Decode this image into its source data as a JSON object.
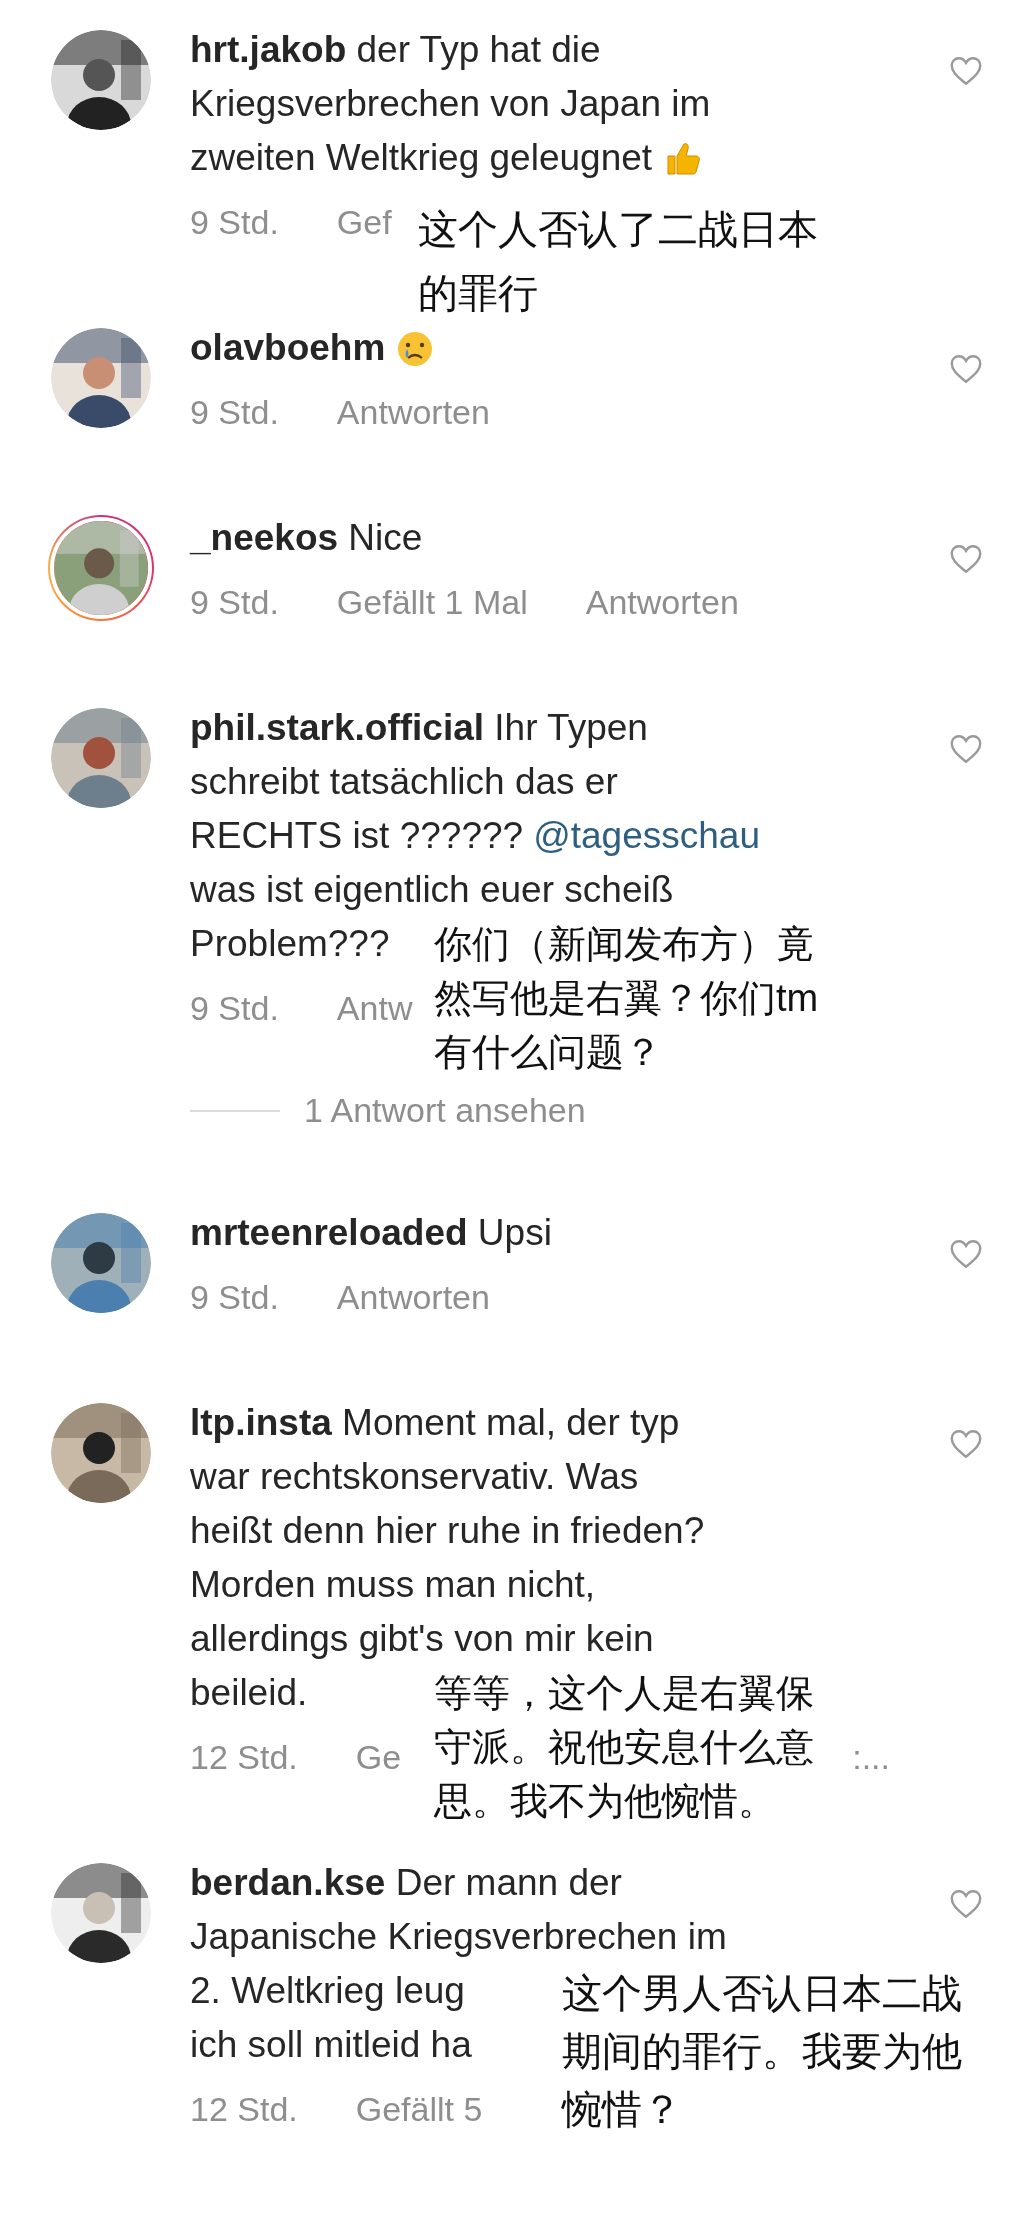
{
  "comments": [
    {
      "avatar": {
        "kind": "picture",
        "story_ring": false
      },
      "lines": [
        [
          {
            "kind": "text",
            "text": "**hrt.jakob** der Typ hat die"
          }
        ],
        [
          {
            "kind": "text",
            "text": "Kriegsverbrechen von Japan im"
          }
        ],
        [
          {
            "kind": "text",
            "text": "zweiten Weltkrieg geleugnet"
          },
          {
            "kind": "thumbs_up_emoji"
          }
        ]
      ],
      "meta": [
        "9 Std.",
        "Gef"
      ],
      "note": {
        "kind": "meta",
        "text": "这个人否认了二战日本的罪行"
      }
    },
    {
      "avatar": {
        "kind": "picture",
        "story_ring": false
      },
      "lines": [
        [
          {
            "kind": "text",
            "text": "**olavboehm**"
          },
          {
            "kind": "crying_emoji"
          }
        ]
      ],
      "meta": [
        "9 Std.",
        "Antworten"
      ]
    },
    {
      "avatar": {
        "kind": "picture",
        "story_ring": true
      },
      "lines": [
        [
          {
            "kind": "text",
            "text": "**_neekos** Nice"
          }
        ]
      ],
      "meta": [
        "9 Std.",
        "Gefällt 1 Mal",
        "Antworten"
      ]
    },
    {
      "avatar": {
        "kind": "picture",
        "story_ring": false
      },
      "lines": [
        [
          {
            "kind": "text",
            "text": "**phil.stark.official** Ihr Typen"
          }
        ],
        [
          {
            "kind": "text",
            "text": "schreibt tatsächlich das er"
          }
        ],
        [
          {
            "kind": "text",
            "text": "RECHTS ist ??????"
          },
          {
            "kind": "mention",
            "text": "@tagesschau"
          }
        ],
        [
          {
            "kind": "text",
            "text": "was ist eigentlich euer scheiß"
          }
        ],
        [
          {
            "kind": "text",
            "text": "Problem???"
          }
        ]
      ],
      "meta": [
        "9 Std.",
        "Antw"
      ],
      "note": {
        "kind": "last_line",
        "text": "你们（新闻发布方）竟然写他是右翼？你们tm有什么问题？"
      },
      "replies_link": "1 Antwort ansehen"
    },
    {
      "avatar": {
        "kind": "picture",
        "story_ring": false
      },
      "lines": [
        [
          {
            "kind": "text",
            "text": "**mrteenreloaded** Upsi"
          }
        ]
      ],
      "meta": [
        "9 Std.",
        "Antworten"
      ]
    },
    {
      "avatar": {
        "kind": "picture",
        "story_ring": false
      },
      "lines": [
        [
          {
            "kind": "text",
            "text": "**ltp.insta** Moment mal, der typ"
          }
        ],
        [
          {
            "kind": "text",
            "text": "war rechtskonservativ. Was"
          }
        ],
        [
          {
            "kind": "text",
            "text": "heißt denn hier ruhe in frieden?"
          }
        ],
        [
          {
            "kind": "text",
            "text": "Morden muss man nicht,"
          }
        ],
        [
          {
            "kind": "text",
            "text": "allerdings gibt's von mir kein"
          }
        ],
        [
          {
            "kind": "text",
            "text": "beileid."
          }
        ]
      ],
      "meta": [
        "12 Std.",
        "Ge"
      ],
      "meta_tail": ":...",
      "note": {
        "kind": "last_line",
        "text": "等等，这个人是右翼保守派。祝他安息什么意思。我不为他惋惜。"
      }
    },
    {
      "avatar": {
        "kind": "picture",
        "story_ring": false
      },
      "lines": [
        [
          {
            "kind": "text",
            "text": "**berdan.kse** Der mann der"
          }
        ],
        [
          {
            "kind": "text",
            "text": "Japanische Kriegsverbrechen im"
          }
        ],
        [
          {
            "kind": "text",
            "text": "2. Weltkrieg leug"
          }
        ],
        [
          {
            "kind": "text",
            "text": "ich soll mitleid ha"
          }
        ]
      ],
      "meta": [
        "12 Std.",
        "Gefällt 5"
      ],
      "note": {
        "kind": "third_line",
        "text": "这个男人否认日本二战期间的罪行。我要为他惋惜？"
      }
    }
  ]
}
